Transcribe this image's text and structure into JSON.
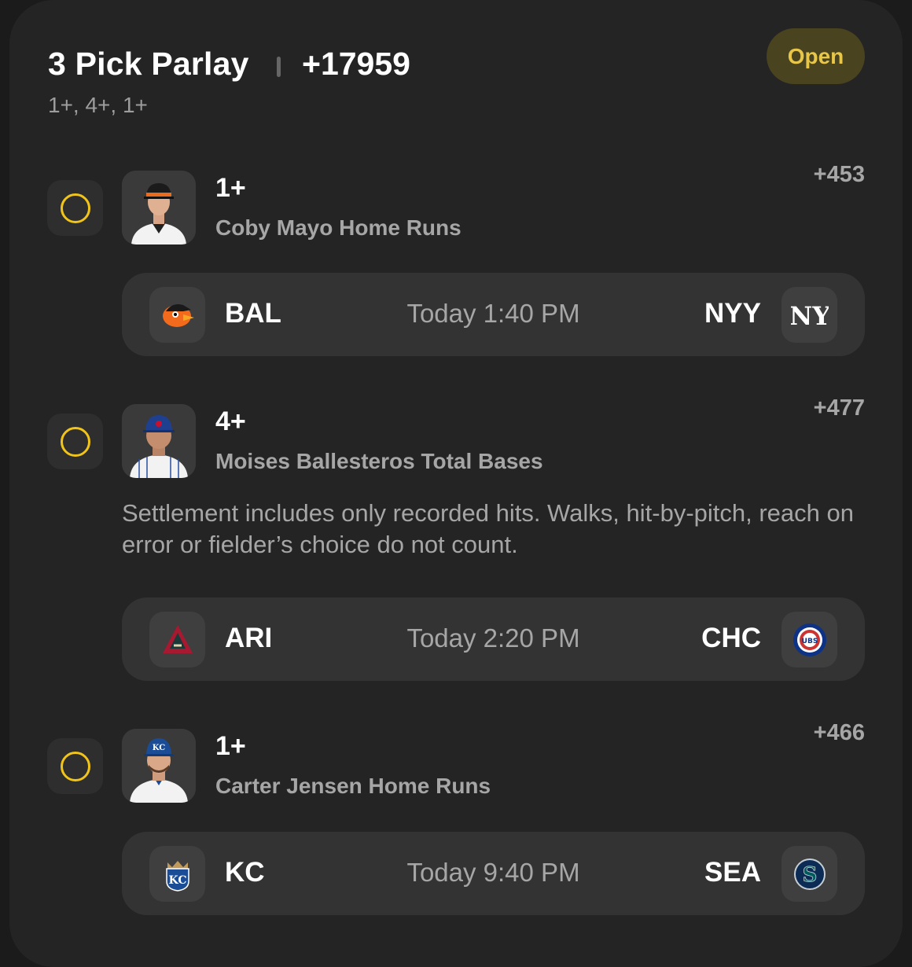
{
  "parlay": {
    "title": "3 Pick Parlay",
    "odds": "+17959",
    "lines_summary": "1+, 4+, 1+",
    "status": "Open"
  },
  "legs": [
    {
      "line": "1+",
      "market": "Coby Mayo Home Runs",
      "odds": "+453",
      "player_photo": "player-headshot-orioles",
      "game": {
        "away": "BAL",
        "away_logo": "orioles-logo",
        "time": "Today 1:40 PM",
        "home": "NYY",
        "home_logo": "yankees-logo"
      }
    },
    {
      "line": "4+",
      "market": "Moises Ballesteros Total Bases",
      "odds": "+477",
      "player_photo": "player-headshot-cubs",
      "note": "Settlement includes only recorded hits. Walks, hit-by-pitch, reach on error or fielder’s choice do not count.",
      "game": {
        "away": "ARI",
        "away_logo": "diamondbacks-logo",
        "time": "Today 2:20 PM",
        "home": "CHC",
        "home_logo": "cubs-logo"
      }
    },
    {
      "line": "1+",
      "market": "Carter Jensen Home Runs",
      "odds": "+466",
      "player_photo": "player-headshot-royals",
      "game": {
        "away": "KC",
        "away_logo": "royals-logo",
        "time": "Today 9:40 PM",
        "home": "SEA",
        "home_logo": "mariners-logo"
      }
    }
  ],
  "colors": {
    "background": "#242424",
    "pending_ring": "#f0c419",
    "status_badge_bg": "#494320",
    "status_badge_text": "#e8c64a",
    "muted_text": "#a6a6a6"
  }
}
